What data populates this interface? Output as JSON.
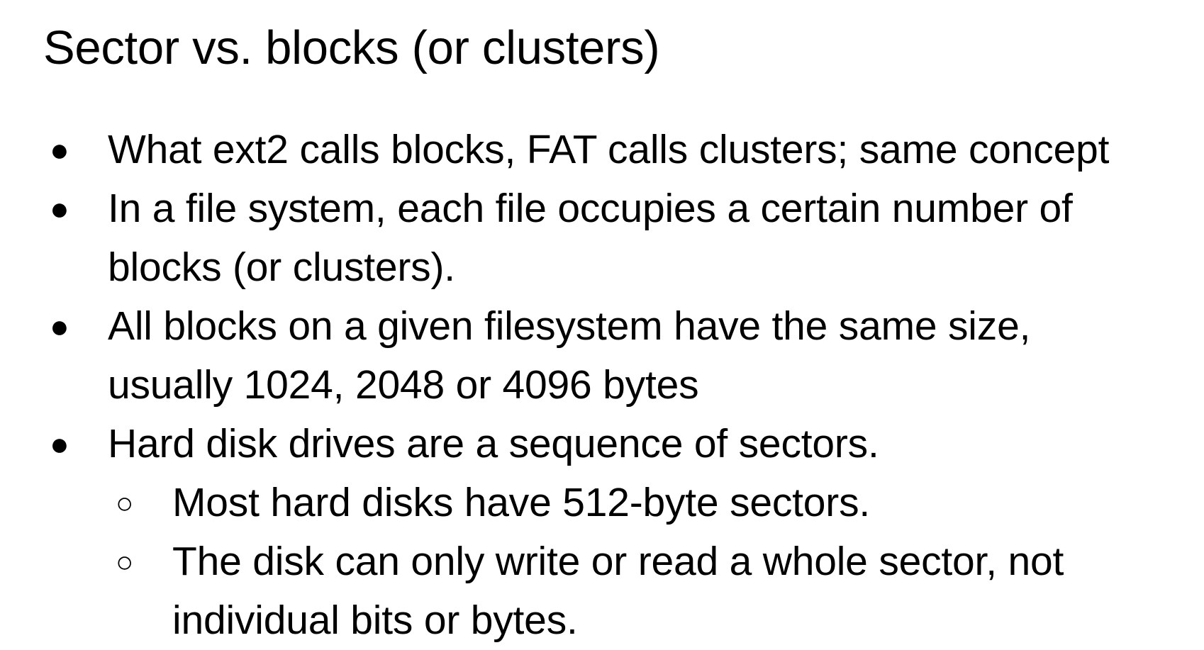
{
  "slide": {
    "title": "Sector vs. blocks (or clusters)",
    "bullets": [
      {
        "marker": "●",
        "lines": [
          "What ext2 calls blocks, FAT calls clusters; same concept"
        ]
      },
      {
        "marker": "●",
        "lines": [
          "In a file system, each file occupies a certain number of",
          "blocks (or clusters)."
        ]
      },
      {
        "marker": "●",
        "lines": [
          "All blocks on a given filesystem have the same size,",
          "usually 1024, 2048 or 4096 bytes"
        ]
      },
      {
        "marker": "●",
        "lines": [
          "Hard disk drives are a sequence of sectors."
        ]
      }
    ],
    "sub_bullets": [
      {
        "marker": "○",
        "lines": [
          "Most hard disks have 512-byte sectors."
        ]
      },
      {
        "marker": "○",
        "lines": [
          "The disk can only write or read a whole sector, not",
          "individual bits or bytes."
        ]
      }
    ]
  }
}
